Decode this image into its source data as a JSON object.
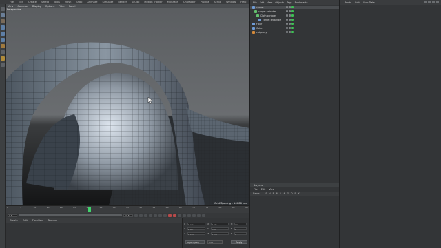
{
  "top_menu": [
    "File",
    "Edit",
    "Create",
    "Select",
    "Tools",
    "Mesh",
    "Snap",
    "Animate",
    "Simulate",
    "Render",
    "Sculpt",
    "Motion Tracker",
    "MoGraph",
    "Character",
    "Plugins",
    "Script",
    "Window",
    "Help"
  ],
  "viewport": {
    "menu": [
      "View",
      "Cameras",
      "Display",
      "Options",
      "Filter",
      "Panel"
    ],
    "label": "Perspective",
    "grid_spacing": "Grid Spacing : 10000 cm"
  },
  "timeline": {
    "ticks": [
      "0",
      "5",
      "10",
      "15",
      "20",
      "25",
      "30",
      "35",
      "40",
      "45",
      "50",
      "55",
      "60",
      "65",
      "70",
      "75",
      "80",
      "85",
      "90"
    ],
    "start_field": "0 F",
    "end_field": "90 F",
    "playhead_progress": 0.34
  },
  "materials": {
    "menu": [
      "Create",
      "Edit",
      "Function",
      "Texture"
    ]
  },
  "coordinates": {
    "rows": [
      [
        "X",
        "0 cm",
        "X",
        "0 cm",
        "H",
        "0°"
      ],
      [
        "Y",
        "0 cm",
        "Y",
        "0 cm",
        "P",
        "0°"
      ],
      [
        "Z",
        "0 cm",
        "Z",
        "0 cm",
        "B",
        "0°"
      ]
    ],
    "mode": "Object (Rel)",
    "size_mode": "Size",
    "apply": "Apply"
  },
  "object_manager": {
    "menu": [
      "File",
      "Edit",
      "View",
      "Objects",
      "Tags",
      "Bookmarks"
    ],
    "objects": [
      {
        "name": "carpet",
        "indent": 0,
        "color": "#6f9cd6"
      },
      {
        "name": "carpet extruder",
        "indent": 1,
        "color": "#63c06e"
      },
      {
        "name": "Cloth surface",
        "indent": 2,
        "color": "#63c06e"
      },
      {
        "name": "carpet rectangle",
        "indent": 3,
        "color": "#6f9cd6"
      },
      {
        "name": "Floor",
        "indent": 0,
        "color": "#6f9cd6"
      },
      {
        "name": "Cube",
        "indent": 0,
        "color": "#6f9cd6"
      },
      {
        "name": "cat proxy",
        "indent": 0,
        "color": "#d58a3a"
      }
    ]
  },
  "layers": {
    "title": "Layers",
    "menu": [
      "File",
      "Edit",
      "View"
    ],
    "header": [
      "Name",
      "S",
      "V",
      "R",
      "M",
      "L",
      "A",
      "G",
      "D",
      "E",
      "X"
    ]
  },
  "attributes": {
    "menu": [
      "Mode",
      "Edit",
      "User Data"
    ]
  },
  "colors": {
    "panel": "#333537",
    "viewport_sky": "#55585b",
    "mesh": "#6c7884",
    "active_frame": "#3fd36b"
  }
}
